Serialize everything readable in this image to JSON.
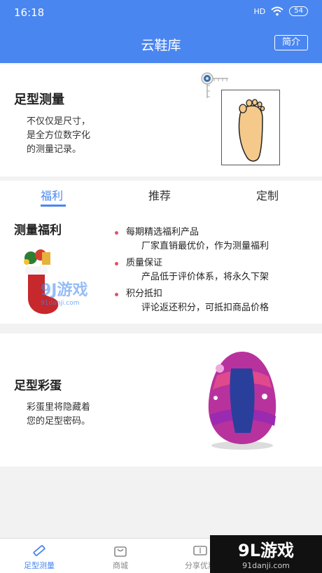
{
  "status": {
    "time": "16:18",
    "network": "HD",
    "battery": "54"
  },
  "header": {
    "title": "云鞋库",
    "intro_button": "简介"
  },
  "measure_card": {
    "title": "足型测量",
    "desc": [
      "不仅仅是尺寸，",
      "是全方位数字化",
      "的测量记录。"
    ]
  },
  "tabs": [
    {
      "label": "福利"
    },
    {
      "label": "推荐"
    },
    {
      "label": "定制"
    }
  ],
  "welfare": {
    "title": "测量福利",
    "items": [
      {
        "title": "每期精选福利产品",
        "desc": "厂家直销最优价，作为测量福利"
      },
      {
        "title": "质量保证",
        "desc": "产品低于评价体系，将永久下架"
      },
      {
        "title": "积分抵扣",
        "desc": "评论返还积分，可抵扣商品价格"
      }
    ],
    "watermark": {
      "main": "9J游戏",
      "sub": "91danji.com"
    }
  },
  "egg_card": {
    "title": "足型彩蛋",
    "desc": [
      "彩蛋里将隐藏着",
      "您的足型密码。"
    ]
  },
  "nav": {
    "items": [
      {
        "label": "足型测量"
      },
      {
        "label": "商城"
      },
      {
        "label": "分享优惠"
      }
    ]
  },
  "brand_watermark": {
    "main": "9L游戏",
    "sub": "91danji.com"
  },
  "colors": {
    "primary": "#4a86f0",
    "bullet": "#e0506a",
    "foot": "#f5c98a"
  }
}
